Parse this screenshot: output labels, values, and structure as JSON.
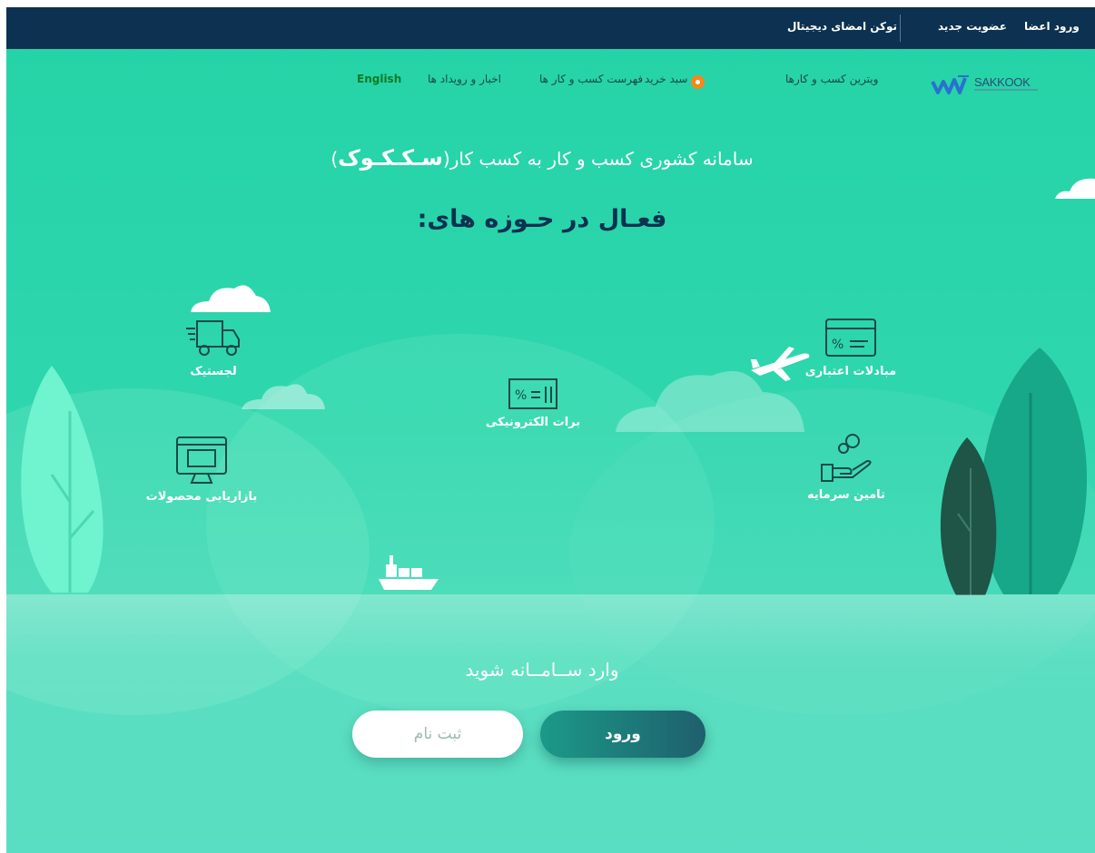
{
  "topbar": {
    "login": "ورود اعضا",
    "register": "عضویت جدید",
    "token": "توکن امضای دیجیتال"
  },
  "nav": {
    "logo_text": "SAKKOOK",
    "showcase": "ویترین کسب و کارها",
    "cart": "سبد خرید",
    "directory": "فهرست کسب و کار ها",
    "news": "اخبار و رویداد ها",
    "language": "English"
  },
  "hero": {
    "tagline": "سامانه کشوری کسب و کار به کسب کار(",
    "brand": "سـکـکـوک",
    "tagline_end": ")",
    "heading": "فعـال در حـوزه های:"
  },
  "domains": {
    "logistics": "لجستیک",
    "marketing": "بازاریابی محصولات",
    "e_invoice": "برات الکترونیکی",
    "credit": "مبادلات اعتباری",
    "funding": "تامین سرمایه"
  },
  "cta": {
    "enter_text": "وارد ســامــانه شوید",
    "login_button": "ورود",
    "register_button": "ثبت نام"
  },
  "colors": {
    "topbar": "#0d3150",
    "background": "#2fd6ae",
    "cart_badge": "#f7861d",
    "english_link": "#127a24"
  }
}
